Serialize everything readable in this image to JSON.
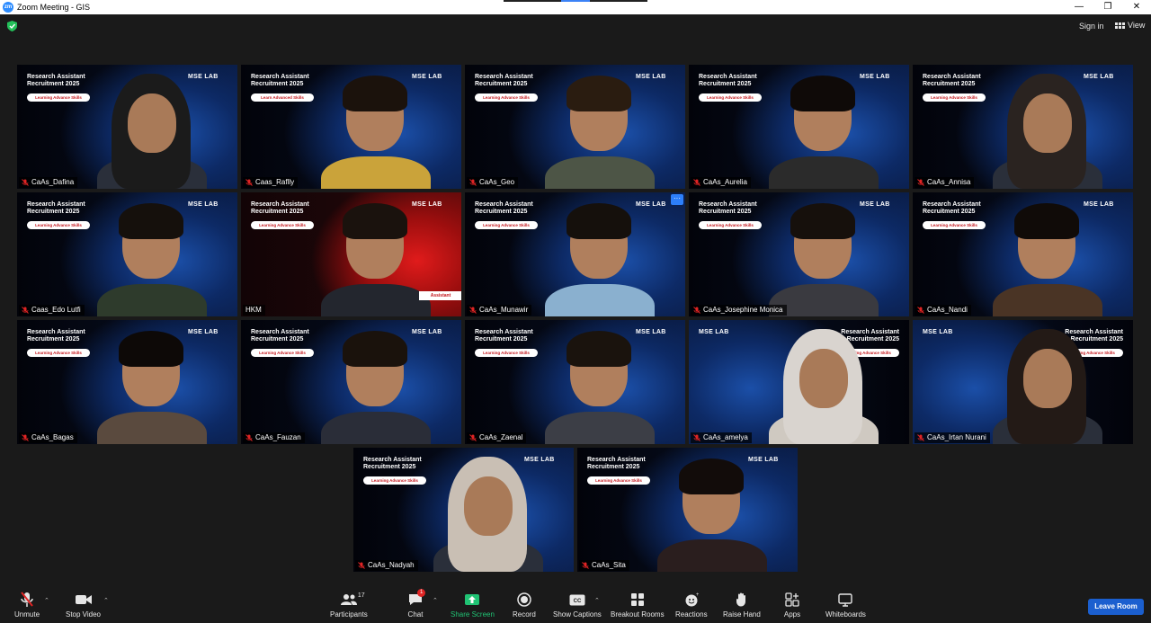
{
  "window": {
    "title": "Zoom Meeting - GIS",
    "controls": [
      "—",
      "❐",
      "✕"
    ]
  },
  "header": {
    "sign_in": "Sign in",
    "view": "View"
  },
  "background": {
    "title_line1": "Research Assistant",
    "title_line2": "Recruitment 2025",
    "pill_default": "Learning Advance Skills",
    "pill_alt": "Learn Advanced Skills",
    "logo": "MSE LAB",
    "assistant_tag": "Assistant"
  },
  "participants": [
    {
      "name": "CaAs_Dafina",
      "muted": true
    },
    {
      "name": "Caas_Raflly",
      "muted": true
    },
    {
      "name": "CaAs_Geo",
      "muted": true
    },
    {
      "name": "CaAs_Aurelia",
      "muted": true
    },
    {
      "name": "CaAs_Annisa",
      "muted": true
    },
    {
      "name": "Caas_Edo Lutfi",
      "muted": true
    },
    {
      "name": "HKM",
      "muted": false
    },
    {
      "name": "CaAs_Munawir",
      "muted": true
    },
    {
      "name": "CaAs_Josephine Monica",
      "muted": true
    },
    {
      "name": "CaAs_Nandi",
      "muted": true
    },
    {
      "name": "CaAs_Bagas",
      "muted": true
    },
    {
      "name": "CaAs_Fauzan",
      "muted": true
    },
    {
      "name": "CaAs_Zaenal",
      "muted": true
    },
    {
      "name": "CaAs_amelya",
      "muted": true
    },
    {
      "name": "CaAs_Irtan Nurani",
      "muted": true
    },
    {
      "name": "CaAs_Nadyah",
      "muted": true
    },
    {
      "name": "CaAs_Sita",
      "muted": true
    }
  ],
  "toolbar": {
    "unmute": "Unmute",
    "stop_video": "Stop Video",
    "participants": "Participants",
    "participants_count": "17",
    "chat": "Chat",
    "chat_badge": "1",
    "share_screen": "Share Screen",
    "record": "Record",
    "show_captions": "Show Captions",
    "breakout_rooms": "Breakout Rooms",
    "reactions": "Reactions",
    "raise_hand": "Raise Hand",
    "apps": "Apps",
    "whiteboards": "Whiteboards",
    "leave_room": "Leave Room",
    "cc": "CC"
  },
  "colors": {
    "accent": "#2d8cff",
    "share_green": "#20c374",
    "leave_blue": "#1b5fcf",
    "active_speaker": "#f3ef9a",
    "muted_red": "#e02424"
  }
}
